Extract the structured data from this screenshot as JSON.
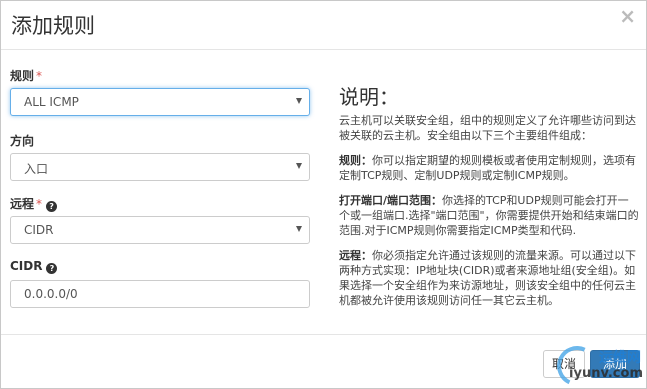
{
  "dialog": {
    "title": "添加规则",
    "close_glyph": "×"
  },
  "form": {
    "rule": {
      "label": "规则",
      "required_mark": "*",
      "selected": "ALL ICMP"
    },
    "direction": {
      "label": "方向",
      "selected": "入口"
    },
    "remote": {
      "label": "远程",
      "required_mark": "*",
      "help_icon": "?",
      "selected": "CIDR"
    },
    "cidr": {
      "label": "CIDR",
      "help_icon": "?",
      "value": "0.0.0.0/0"
    }
  },
  "description": {
    "title": "说明：",
    "intro": "云主机可以关联安全组，组中的规则定义了允许哪些访问到达被关联的云主机。安全组由以下三个主要组件组成：",
    "rule_term": "规则：",
    "rule_text": "你可以指定期望的规则模板或者使用定制规则，选项有定制TCP规则、定制UDP规则或定制ICMP规则。",
    "port_term": "打开端口/端口范围：",
    "port_text": "你选择的TCP和UDP规则可能会打开一个或一组端口.选择\"端口范围\"，你需要提供开始和结束端口的范围.对于ICMP规则你需要指定ICMP类型和代码.",
    "remote_term": "远程：",
    "remote_text": "你必须指定允许通过该规则的流量来源。可以通过以下两种方式实现：IP地址块(CIDR)或者来源地址组(安全组)。如果选择一个安全组作为来访源地址，则该安全组中的任何云主机都被允许使用该规则访问任一其它云主机。"
  },
  "footer": {
    "cancel_label": "取消",
    "add_label": "添加"
  },
  "watermark": {
    "brand": "运维网",
    "url": "iyunv.com"
  },
  "colors": {
    "primary": "#337ab7",
    "required": "#d9534f",
    "focus": "#66afe9"
  }
}
